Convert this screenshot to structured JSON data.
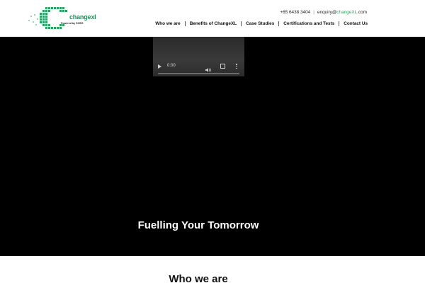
{
  "logo": {
    "brand": "change",
    "brand_suffix": "xl",
    "tagline": "Powered by SOEG"
  },
  "contact": {
    "phone": "+65 6438 3404",
    "email_prefix": "enquiry@",
    "email_domain": "changeXL",
    "email_suffix": ".com"
  },
  "nav": {
    "items": [
      {
        "label": "Who we are"
      },
      {
        "label": "Benefits of ChangeXL"
      },
      {
        "label": "Case Studies"
      },
      {
        "label": "Certifications and Tests"
      },
      {
        "label": "Contact Us"
      }
    ]
  },
  "video": {
    "time": "0:00"
  },
  "hero": {
    "tagline": "Fuelling Your Tomorrow"
  },
  "section": {
    "title": "Who we are"
  },
  "colors": {
    "accent": "#2aa15f",
    "hero_bg": "#000000"
  }
}
